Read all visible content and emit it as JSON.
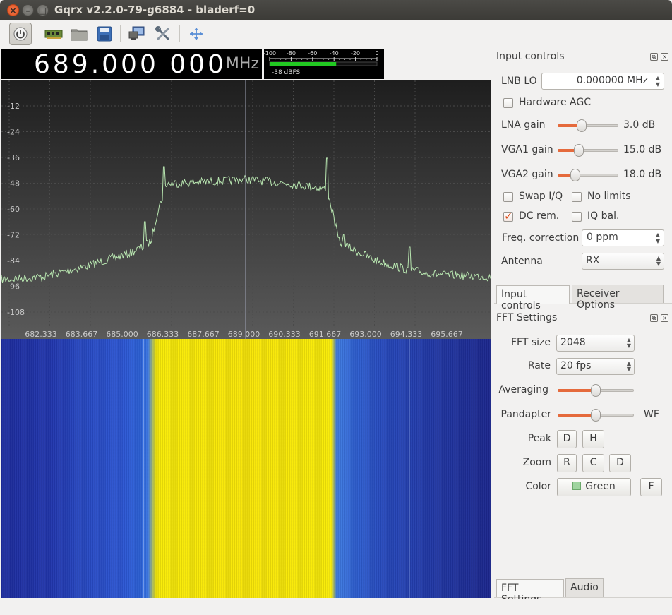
{
  "window": {
    "title": "Gqrx v2.2.0-79-g6884 - bladerf=0"
  },
  "toolbar": {
    "items": [
      "power-icon",
      "device-icon",
      "open-folder-icon",
      "save-icon",
      "network-icon",
      "tools-icon",
      "fullscreen-icon"
    ]
  },
  "frequency": {
    "value": "689.000 000",
    "unit": "MHz"
  },
  "meter": {
    "scale": [
      "-100",
      "-80",
      "-60",
      "-40",
      "-20",
      "0"
    ],
    "level_text": "-38 dBFS",
    "level_fraction": 0.62,
    "bar_color": "#22c922"
  },
  "spectrum": {
    "y_ticks": [
      "-12",
      "-24",
      "-36",
      "-48",
      "-60",
      "-72",
      "-84",
      "-96",
      "-108"
    ],
    "x_ticks": [
      "682.333",
      "683.667",
      "685.000",
      "686.333",
      "687.667",
      "689.000",
      "690.333",
      "691.667",
      "693.000",
      "694.333",
      "695.667"
    ],
    "trace_color": "#b8e6b0",
    "background_top": "#1e1e1e",
    "background_bottom": "#5a5a5a"
  },
  "input_controls": {
    "title": "Input controls",
    "lnb_lo_label": "LNB LO",
    "lnb_lo_value": "0.000000 MHz",
    "hw_agc_label": "Hardware AGC",
    "hw_agc_checked": false,
    "gains": [
      {
        "label": "LNA gain",
        "value": "3.0 dB",
        "level": 0.38
      },
      {
        "label": "VGA1 gain",
        "value": "15.0 dB",
        "level": 0.32
      },
      {
        "label": "VGA2 gain",
        "value": "18.0 dB",
        "level": 0.25
      }
    ],
    "swap_iq_label": "Swap I/Q",
    "swap_iq_checked": false,
    "no_limits_label": "No limits",
    "no_limits_checked": false,
    "dc_rem_label": "DC rem.",
    "dc_rem_checked": true,
    "iq_bal_label": "IQ bal.",
    "iq_bal_checked": false,
    "freq_corr_label": "Freq. correction",
    "freq_corr_value": "0 ppm",
    "antenna_label": "Antenna",
    "antenna_value": "RX"
  },
  "top_tabs": {
    "tab1": "Input controls",
    "tab2": "Receiver Options"
  },
  "fft_settings": {
    "title": "FFT Settings",
    "fft_size_label": "FFT size",
    "fft_size_value": "2048",
    "rate_label": "Rate",
    "rate_value": "20 fps",
    "averaging_label": "Averaging",
    "averaging_level": 0.5,
    "pandapter_label": "Pandapter",
    "pandapter_level": 0.5,
    "wf_label": "WF",
    "peak_label": "Peak",
    "peak_d": "D",
    "peak_h": "H",
    "zoom_label": "Zoom",
    "zoom_r": "R",
    "zoom_c": "C",
    "zoom_d": "D",
    "color_label": "Color",
    "color_value": "Green",
    "color_swatch": "#9fd49f",
    "fill_button": "F"
  },
  "bottom_tabs": {
    "tab1": "FFT Settings",
    "tab2": "Audio"
  }
}
